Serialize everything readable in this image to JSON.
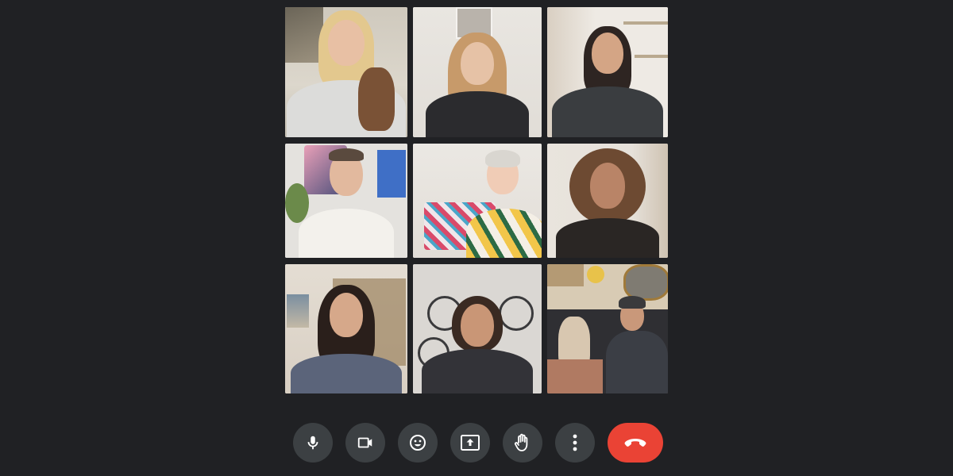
{
  "meeting": {
    "participants": [
      {
        "id": "p1",
        "background": "#d9d4ca",
        "accent": "#6b5f55",
        "skin": "#e8c0a4",
        "hair": "#e3c88e",
        "shirt": "#dcdcda"
      },
      {
        "id": "p2",
        "background": "#e8e4df",
        "accent": "#b9b3ab",
        "skin": "#e6c2a6",
        "hair": "#c79a6a",
        "shirt": "#2b2b2e"
      },
      {
        "id": "p3",
        "background": "#ece7e0",
        "accent": "#c8b79e",
        "skin": "#d4a585",
        "hair": "#2e2522",
        "shirt": "#3a3d40"
      },
      {
        "id": "p4",
        "background": "#e4e2de",
        "accent": "#3f6fc6",
        "skin": "#e2b99e",
        "hair": "#5a4a3e",
        "shirt": "#f3f1ec"
      },
      {
        "id": "p5",
        "background": "#e2ddd7",
        "accent": "#d94a6a",
        "skin": "#f0ccb6",
        "hair": "#d9d6d0",
        "shirt": "#f2c64a"
      },
      {
        "id": "p6",
        "background": "#e6e1da",
        "accent": "#b8a690",
        "skin": "#b98467",
        "hair": "#6d4a32",
        "shirt": "#2a2624"
      },
      {
        "id": "p7",
        "background": "#e0d9cf",
        "accent": "#a08866",
        "skin": "#d6a88a",
        "hair": "#2a1f1b",
        "shirt": "#5b647a"
      },
      {
        "id": "p8",
        "background": "#dad7d3",
        "accent": "#3a3a3c",
        "skin": "#c99676",
        "hair": "#3a2a22",
        "shirt": "#333338"
      },
      {
        "id": "p9",
        "background": "#d8cbb4",
        "accent": "#2f2f33",
        "skin": "#c9987a",
        "hair": "#3a3a3c",
        "shirt": "#3b3e45"
      }
    ]
  },
  "controls": {
    "end_call_color": "#ea4335",
    "button_color": "#3c4043",
    "icons": [
      "microphone-icon",
      "camera-icon",
      "emoji-icon",
      "present-screen-icon",
      "raise-hand-icon",
      "more-options-icon",
      "end-call-icon"
    ]
  }
}
